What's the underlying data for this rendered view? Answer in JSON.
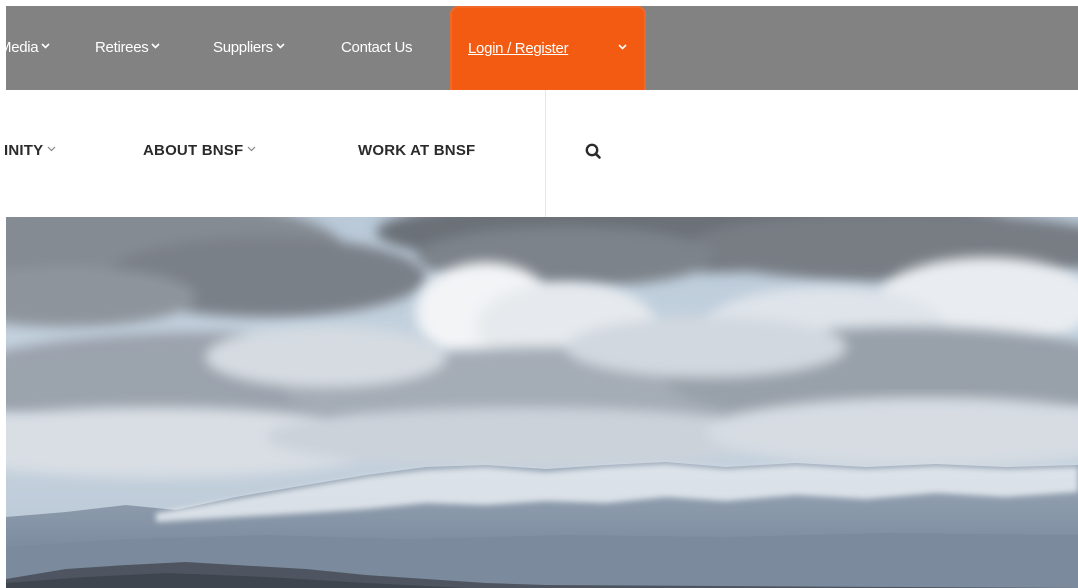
{
  "utility_nav": {
    "items": [
      {
        "label": "Media"
      },
      {
        "label": "Retirees"
      },
      {
        "label": "Suppliers"
      },
      {
        "label": "Contact Us"
      }
    ],
    "login": {
      "label": "Login / Register"
    }
  },
  "main_nav": {
    "items": [
      {
        "label": "INITY"
      },
      {
        "label": "ABOUT BNSF"
      },
      {
        "label": "WORK AT BNSF"
      }
    ],
    "search_icon": "search-icon"
  },
  "hero": {
    "image": "mountain-landscape-with-clouds"
  },
  "colors": {
    "utility_bar": "#828282",
    "login_accent": "#f35b13",
    "highlight_border": "#ef6a2a",
    "nav_text": "#2b2b2b"
  }
}
